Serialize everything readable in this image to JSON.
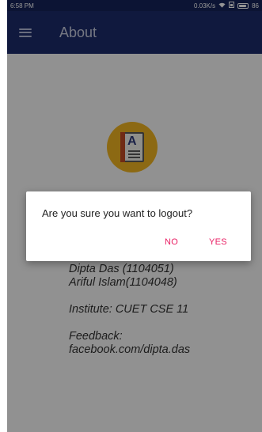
{
  "status_bar": {
    "time": "6:58 PM",
    "network_speed": "0.03K/s",
    "battery_text": "86",
    "icons": [
      "wifi-icon",
      "sim-icon",
      "battery-icon"
    ],
    "battery_level": 0.86
  },
  "app_bar": {
    "title": "About",
    "menu_icon": "hamburger-menu-icon",
    "background": "#1d2b6b"
  },
  "about": {
    "logo_icon": "address-book-icon",
    "logo_letter": "A",
    "lines": [
      "Dipta Das (1104051)",
      "Ariful Islam(1104048)",
      "Institute: CUET CSE 11",
      "Feedback:",
      "facebook.com/dipta.das"
    ]
  },
  "dialog": {
    "message": "Are you sure you want to logout?",
    "negative_label": "NO",
    "positive_label": "YES",
    "button_color": "#e91e63"
  }
}
